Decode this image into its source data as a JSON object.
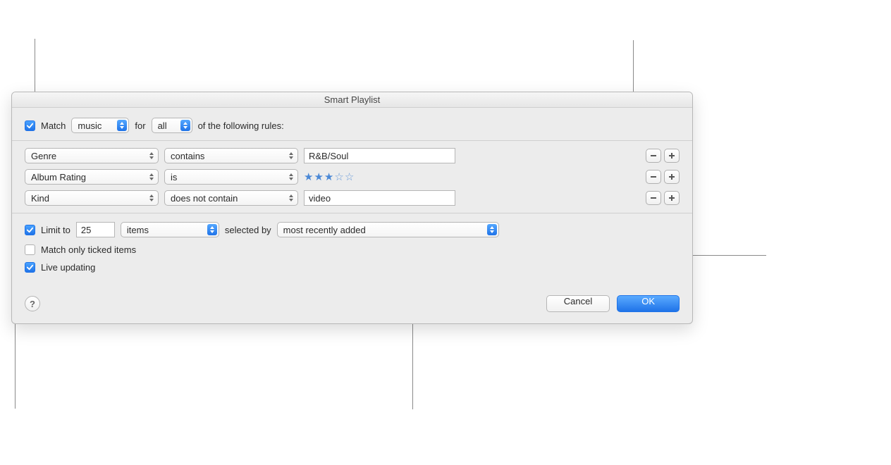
{
  "title": "Smart Playlist",
  "match": {
    "enabled": true,
    "label": "Match",
    "media": "music",
    "for_label": "for",
    "scope": "all",
    "tail": "of the following rules:"
  },
  "rules": [
    {
      "field": "Genre",
      "op": "contains",
      "value_type": "text",
      "value": "R&B/Soul"
    },
    {
      "field": "Album Rating",
      "op": "is",
      "value_type": "stars",
      "stars": 3,
      "stars_max": 5
    },
    {
      "field": "Kind",
      "op": "does not contain",
      "value_type": "text",
      "value": "video"
    }
  ],
  "limit": {
    "enabled": true,
    "label": "Limit to",
    "count": "25",
    "unit": "items",
    "selected_by_label": "selected by",
    "selected_by": "most recently added"
  },
  "match_ticked": {
    "enabled": false,
    "label": "Match only ticked items"
  },
  "live": {
    "enabled": true,
    "label": "Live updating"
  },
  "buttons": {
    "help": "?",
    "cancel": "Cancel",
    "ok": "OK"
  }
}
